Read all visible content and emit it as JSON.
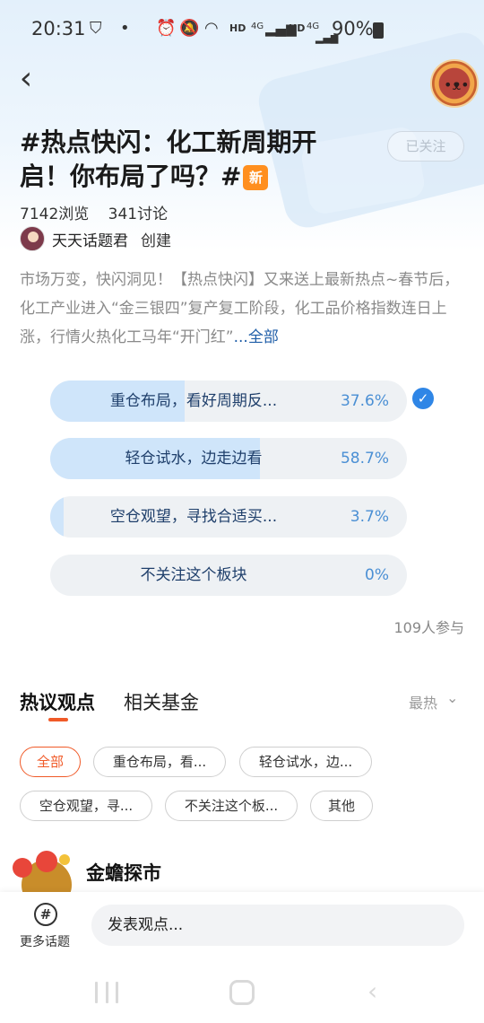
{
  "status_bar": {
    "time": "20:31",
    "battery": "90%",
    "icons": [
      "shield-icon",
      "dot-icon",
      "alarm-icon",
      "mute-icon",
      "wifi-icon",
      "signal-icon",
      "signal-icon",
      "battery-icon"
    ],
    "hd1": "HD",
    "net1": "4G",
    "hd2": "HD",
    "net2": "4G"
  },
  "topic": {
    "title": "#热点快闪：化工新周期开启！你布局了吗？#",
    "new_badge": "新",
    "follow_label": "已关注",
    "views": "7142浏览",
    "discussions": "341讨论",
    "creator_name": "天天话题君",
    "creator_action": "创建",
    "description": "市场万变，快闪洞见！【热点快闪】又来送上最新热点~春节后，化工产业进入“金三银四”复产复工阶段，化工品价格指数连日上涨，行情火热化工马年“开门红”",
    "more_link": "...全部"
  },
  "poll": {
    "options": [
      {
        "label": "重仓布局，看好周期反...",
        "percent": "37.6%",
        "value": 37.6,
        "selected": true
      },
      {
        "label": "轻仓试水，边走边看",
        "percent": "58.7%",
        "value": 58.7,
        "selected": false
      },
      {
        "label": "空仓观望，寻找合适买...",
        "percent": "3.7%",
        "value": 3.7,
        "selected": false
      },
      {
        "label": "不关注这个板块",
        "percent": "0%",
        "value": 0,
        "selected": false
      }
    ],
    "participants": "109人参与"
  },
  "tabs": {
    "active": "热议观点",
    "inactive": "相关基金",
    "sort": "最热"
  },
  "filters": [
    "全部",
    "重仓布局，看...",
    "轻仓试水，边...",
    "空仓观望，寻...",
    "不关注这个板...",
    "其他"
  ],
  "post": {
    "author": "金蟾探市"
  },
  "bottom_bar": {
    "more_topics": "更多话题",
    "input_placeholder": "发表观点..."
  },
  "colors": {
    "accent": "#f05a28",
    "poll_fill": "#cfe5fa",
    "poll_text": "#1f3f6b",
    "check": "#2f86e6",
    "badge": "#ff8f1f"
  }
}
